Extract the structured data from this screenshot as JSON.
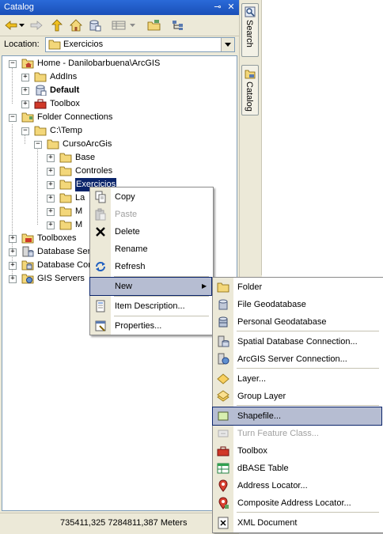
{
  "window": {
    "title": "Catalog",
    "pin_glyph": "⊸",
    "close_glyph": "✕"
  },
  "location": {
    "label": "Location:",
    "value": "Exercicios"
  },
  "tree": {
    "items": [
      {
        "label": "Home - Danilobarbuena\\ArcGIS",
        "expander": "−"
      },
      {
        "label": "AddIns",
        "expander": "+"
      },
      {
        "label": "Default",
        "expander": "+"
      },
      {
        "label": "Toolbox",
        "expander": "+"
      },
      {
        "label": "Folder Connections",
        "expander": "−"
      },
      {
        "label": "C:\\Temp",
        "expander": "−"
      },
      {
        "label": "CursoArcGis",
        "expander": "−"
      },
      {
        "label": "Base",
        "expander": "+"
      },
      {
        "label": "Controles",
        "expander": "+"
      },
      {
        "label": "Exercicios",
        "expander": "+"
      },
      {
        "label": "La",
        "expander": "+"
      },
      {
        "label": "M",
        "expander": "+"
      },
      {
        "label": "M",
        "expander": "+"
      },
      {
        "label": "Toolboxes",
        "expander": "+"
      },
      {
        "label": "Database Ser",
        "expander": "+"
      },
      {
        "label": "Database Con",
        "expander": "+"
      },
      {
        "label": "GIS Servers",
        "expander": "+"
      }
    ]
  },
  "context_menu": {
    "items": [
      {
        "label": "Copy"
      },
      {
        "label": "Paste"
      },
      {
        "label": "Delete"
      },
      {
        "label": "Rename"
      },
      {
        "label": "Refresh"
      },
      {
        "label": "New",
        "submenu_arrow": "▶"
      },
      {
        "label": "Item Description..."
      },
      {
        "label": "Properties..."
      }
    ]
  },
  "new_submenu": {
    "items": [
      {
        "label": "Folder"
      },
      {
        "label": "File Geodatabase"
      },
      {
        "label": "Personal Geodatabase"
      },
      {
        "label": "Spatial Database Connection..."
      },
      {
        "label": "ArcGIS Server Connection..."
      },
      {
        "label": "Layer..."
      },
      {
        "label": "Group Layer"
      },
      {
        "label": "Shapefile..."
      },
      {
        "label": "Turn Feature Class..."
      },
      {
        "label": "Toolbox"
      },
      {
        "label": "dBASE Table"
      },
      {
        "label": "Address Locator..."
      },
      {
        "label": "Composite Address Locator..."
      },
      {
        "label": "XML Document"
      }
    ]
  },
  "dock": {
    "search_tab": "Search",
    "catalog_tab": "Catalog"
  },
  "status": {
    "coordinates": "735411,325  7284811,387 Meters"
  },
  "colors": {
    "titlebar": "#1a4fb8",
    "selection": "#0a246a",
    "menu_highlight": "#b6bdd2",
    "folder": "#f3d77a"
  }
}
